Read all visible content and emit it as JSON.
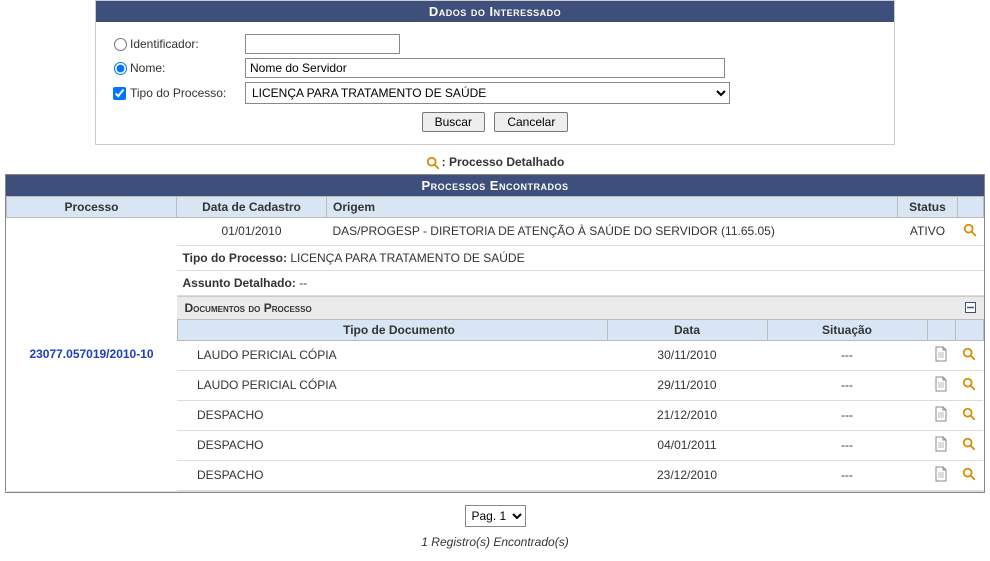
{
  "form": {
    "header": "Dados do Interessado",
    "identificador_label": "Identificador:",
    "identificador_value": "",
    "nome_label": "Nome:",
    "nome_value": "Nome do Servidor",
    "tipo_label": "Tipo do Processo:",
    "tipo_value": "LICENÇA PARA TRATAMENTO DE SAÚDE",
    "buscar": "Buscar",
    "cancelar": "Cancelar",
    "search_by": "nome",
    "tipo_checked": true
  },
  "legend": {
    "label": ": Processo Detalhado"
  },
  "results": {
    "header": "Processos Encontrados",
    "cols": {
      "processo": "Processo",
      "data": "Data de Cadastro",
      "origem": "Origem",
      "status": "Status"
    },
    "row": {
      "processo": "23077.057019/2010-10",
      "data": "01/01/2010",
      "origem": "DAS/PROGESP - DIRETORIA DE ATENÇÃO À SAÚDE DO SERVIDOR (11.65.05)",
      "status": "ATIVO",
      "tipo_label": "Tipo do Processo:",
      "tipo_value": "LICENÇA PARA TRATAMENTO DE SAÚDE",
      "assunto_label": "Assunto Detalhado:",
      "assunto_value": "--"
    },
    "docs": {
      "header": "Documentos do Processo",
      "cols": {
        "tipo": "Tipo de Documento",
        "data": "Data",
        "sit": "Situação"
      },
      "rows": [
        {
          "tipo": "LAUDO PERICIAL CÓPIA",
          "data": "30/11/2010",
          "sit": "---"
        },
        {
          "tipo": "LAUDO PERICIAL CÓPIA",
          "data": "29/11/2010",
          "sit": "---"
        },
        {
          "tipo": "DESPACHO",
          "data": "21/12/2010",
          "sit": "---"
        },
        {
          "tipo": "DESPACHO",
          "data": "04/01/2011",
          "sit": "---"
        },
        {
          "tipo": "DESPACHO",
          "data": "23/12/2010",
          "sit": "---"
        }
      ]
    }
  },
  "pager": {
    "label": "Pag. 1"
  },
  "footer": {
    "count": "1 Registro(s) Encontrado(s)"
  }
}
